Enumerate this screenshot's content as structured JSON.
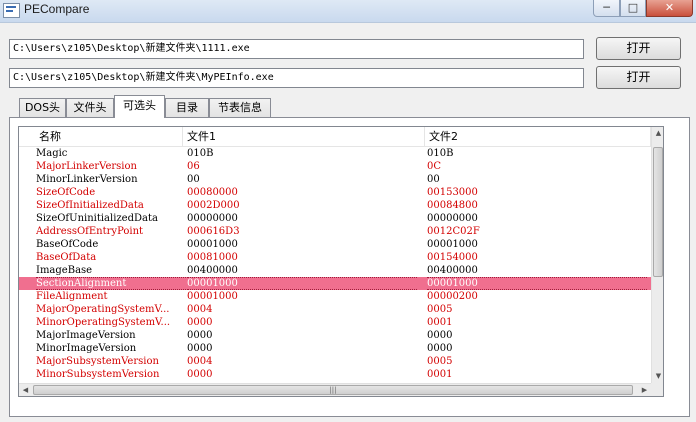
{
  "window": {
    "title": "PECompare"
  },
  "files": [
    {
      "path": "C:\\Users\\z105\\Desktop\\新建文件夹\\1111.exe",
      "button": "打开"
    },
    {
      "path": "C:\\Users\\z105\\Desktop\\新建文件夹\\MyPEInfo.exe",
      "button": "打开"
    }
  ],
  "tabs": [
    {
      "label": "DOS头",
      "active": false
    },
    {
      "label": "文件头",
      "active": false
    },
    {
      "label": "可选头",
      "active": true
    },
    {
      "label": "目录",
      "active": false
    },
    {
      "label": "节表信息",
      "active": false
    }
  ],
  "table": {
    "columns": [
      "名称",
      "文件1",
      "文件2"
    ],
    "rows": [
      {
        "name": "Magic",
        "file1": "010B",
        "file2": "010B",
        "state": "same"
      },
      {
        "name": "MajorLinkerVersion",
        "file1": "06",
        "file2": "0C",
        "state": "diff"
      },
      {
        "name": "MinorLinkerVersion",
        "file1": "00",
        "file2": "00",
        "state": "same"
      },
      {
        "name": "SizeOfCode",
        "file1": "00080000",
        "file2": "00153000",
        "state": "diff"
      },
      {
        "name": "SizeOfInitializedData",
        "file1": "0002D000",
        "file2": "00084800",
        "state": "diff"
      },
      {
        "name": "SizeOfUninitializedData",
        "file1": "00000000",
        "file2": "00000000",
        "state": "same"
      },
      {
        "name": "AddressOfEntryPoint",
        "file1": "000616D3",
        "file2": "0012C02F",
        "state": "diff"
      },
      {
        "name": "BaseOfCode",
        "file1": "00001000",
        "file2": "00001000",
        "state": "same"
      },
      {
        "name": "BaseOfData",
        "file1": "00081000",
        "file2": "00154000",
        "state": "diff"
      },
      {
        "name": "ImageBase",
        "file1": "00400000",
        "file2": "00400000",
        "state": "same"
      },
      {
        "name": "SectionAlignment",
        "file1": "00001000",
        "file2": "00001000",
        "state": "selected"
      },
      {
        "name": "FileAlignment",
        "file1": "00001000",
        "file2": "00000200",
        "state": "diff"
      },
      {
        "name": "MajorOperatingSystemV...",
        "file1": "0004",
        "file2": "0005",
        "state": "diff"
      },
      {
        "name": "MinorOperatingSystemV...",
        "file1": "0000",
        "file2": "0001",
        "state": "diff"
      },
      {
        "name": "MajorImageVersion",
        "file1": "0000",
        "file2": "0000",
        "state": "same"
      },
      {
        "name": "MinorImageVersion",
        "file1": "0000",
        "file2": "0000",
        "state": "same"
      },
      {
        "name": "MajorSubsystemVersion",
        "file1": "0004",
        "file2": "0005",
        "state": "diff"
      },
      {
        "name": "MinorSubsystemVersion",
        "file1": "0000",
        "file2": "0001",
        "state": "diff"
      }
    ]
  },
  "colors": {
    "diff_text": "#d30000",
    "selected_row": "#f06f8f"
  },
  "icons": {
    "window_minimize": "minimize-icon",
    "window_maximize": "maximize-icon",
    "window_close": "close-icon"
  }
}
